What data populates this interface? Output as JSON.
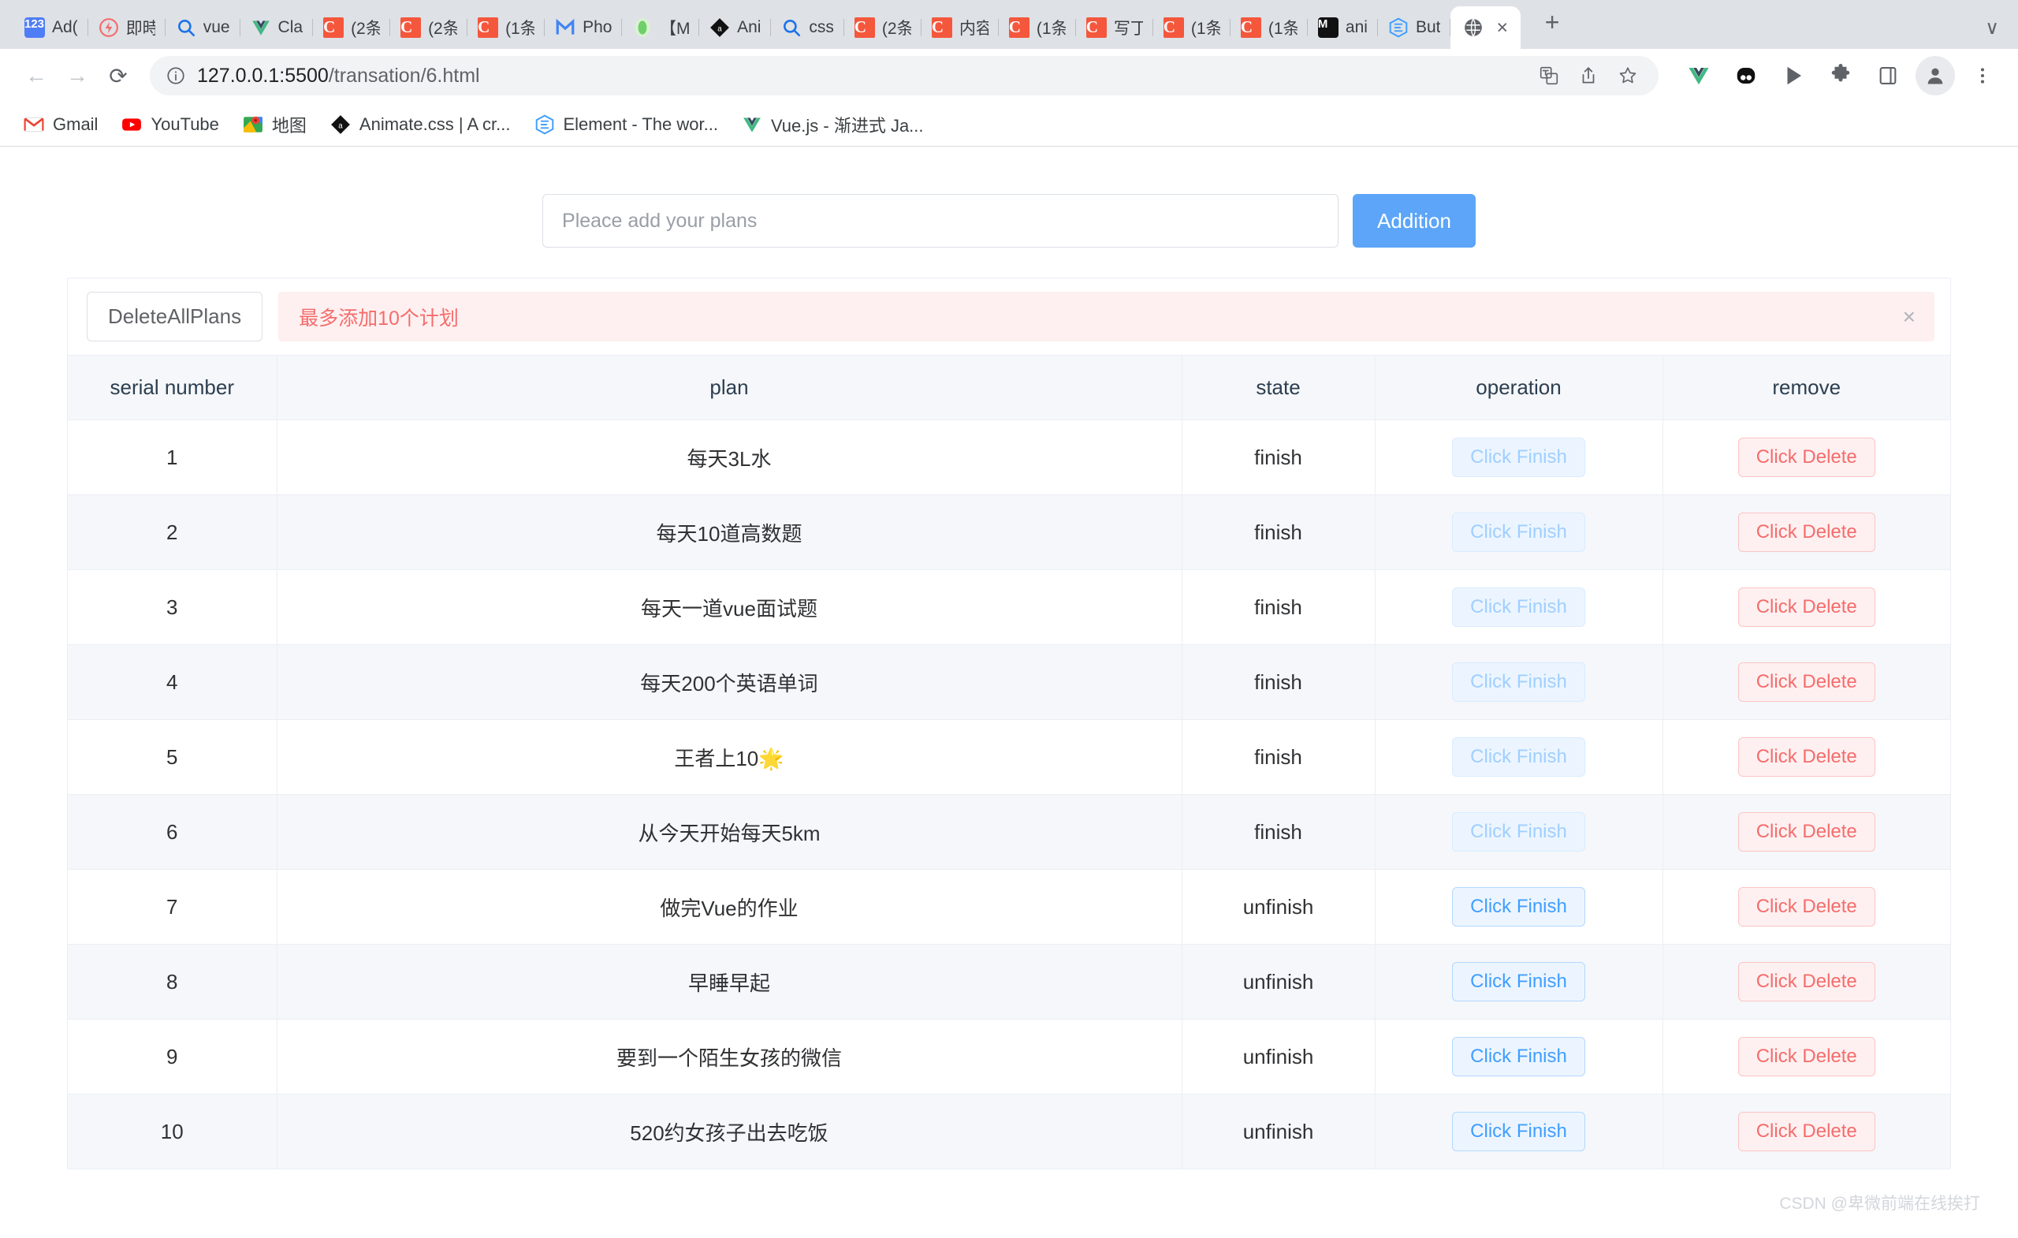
{
  "browser": {
    "tabs": [
      {
        "label": "Ad(",
        "icon": "123-blue-icon",
        "icon_type": "sq",
        "icon_bg": "#4f7df5",
        "icon_text": "123"
      },
      {
        "label": "即時",
        "icon": "lightning-red-icon",
        "icon_type": "circle",
        "icon_bg": "#f56c6c",
        "icon_text": "⚡"
      },
      {
        "label": "vue",
        "icon": "search-blue-icon",
        "icon_type": "glyph",
        "icon_bg": "",
        "icon_text": "🔍"
      },
      {
        "label": "Cla",
        "icon": "vue-icon",
        "icon_type": "vue",
        "icon_bg": "",
        "icon_text": ""
      },
      {
        "label": "(2条",
        "icon": "csdn-icon",
        "icon_type": "c",
        "icon_bg": "#f4573c",
        "icon_text": "C"
      },
      {
        "label": "(2条",
        "icon": "csdn-icon",
        "icon_type": "c",
        "icon_bg": "#f4573c",
        "icon_text": "C"
      },
      {
        "label": "(1条",
        "icon": "csdn-icon",
        "icon_type": "c",
        "icon_bg": "#f4573c",
        "icon_text": "C"
      },
      {
        "label": "Pho",
        "icon": "gmail-m-icon",
        "icon_type": "m",
        "icon_bg": "",
        "icon_text": "M"
      },
      {
        "label": "【M",
        "icon": "green-leaf-icon",
        "icon_type": "leaf",
        "icon_bg": "#6fcf6a",
        "icon_text": ""
      },
      {
        "label": "Ani",
        "icon": "animate-css-icon",
        "icon_type": "diamond",
        "icon_bg": "#111111",
        "icon_text": "a"
      },
      {
        "label": "css",
        "icon": "search-blue-icon",
        "icon_type": "glyph",
        "icon_bg": "",
        "icon_text": "🔍"
      },
      {
        "label": "(2条",
        "icon": "csdn-icon",
        "icon_type": "c",
        "icon_bg": "#f4573c",
        "icon_text": "C"
      },
      {
        "label": "内容",
        "icon": "csdn-icon",
        "icon_type": "c",
        "icon_bg": "#f4573c",
        "icon_text": "C"
      },
      {
        "label": "(1条",
        "icon": "csdn-icon",
        "icon_type": "c",
        "icon_bg": "#f4573c",
        "icon_text": "C"
      },
      {
        "label": "写丁",
        "icon": "csdn-icon",
        "icon_type": "c",
        "icon_bg": "#f4573c",
        "icon_text": "C"
      },
      {
        "label": "(1条",
        "icon": "csdn-icon",
        "icon_type": "c",
        "icon_bg": "#f4573c",
        "icon_text": "C"
      },
      {
        "label": "(1条",
        "icon": "csdn-icon",
        "icon_type": "c",
        "icon_bg": "#f4573c",
        "icon_text": "C"
      },
      {
        "label": "ani",
        "icon": "medium-icon",
        "icon_type": "sq",
        "icon_bg": "#111111",
        "icon_text": "M"
      },
      {
        "label": "But",
        "icon": "element-ui-icon",
        "icon_type": "element",
        "icon_bg": "",
        "icon_text": ""
      }
    ],
    "active_tab": {
      "label": "",
      "icon": "globe-icon",
      "close_label": "×"
    },
    "new_tab_label": "+",
    "tab_list_label": "∨",
    "nav": {
      "back_label": "←",
      "forward_label": "→",
      "reload_label": "⟳",
      "site_info_label": "ⓘ"
    },
    "url": {
      "host": "127.0.0.1:5500",
      "path": "/transation/6.html"
    },
    "omnibox_actions": [
      "translate-icon",
      "share-icon",
      "bookmark-star-icon"
    ],
    "toolbar_icons": [
      "vue-devtools-icon",
      "extension-dark-icon",
      "play-icon",
      "puzzle-icon",
      "sidepanel-icon",
      "profile-avatar-icon",
      "chrome-menu-icon"
    ],
    "bookmarks": [
      {
        "label": "Gmail",
        "icon": "gmail-icon"
      },
      {
        "label": "YouTube",
        "icon": "youtube-icon"
      },
      {
        "label": "地图",
        "icon": "google-maps-icon"
      },
      {
        "label": "Animate.css | A cr...",
        "icon": "animate-css-icon"
      },
      {
        "label": "Element - The wor...",
        "icon": "element-ui-icon"
      },
      {
        "label": "Vue.js - 渐进式 Ja...",
        "icon": "vue-icon"
      }
    ]
  },
  "app": {
    "input": {
      "placeholder": "Pleace add your plans",
      "value": ""
    },
    "add_button_label": "Addition",
    "delete_all_label": "DeleteAllPlans",
    "alert": {
      "text": "最多添加10个计划",
      "close_label": "×"
    },
    "table": {
      "columns": [
        "serial number",
        "plan",
        "state",
        "operation",
        "remove"
      ],
      "finish_label": "Click Finish",
      "delete_label": "Click Delete",
      "rows": [
        {
          "serial": "1",
          "plan": "每天3L水",
          "state": "finish",
          "finish_enabled": false
        },
        {
          "serial": "2",
          "plan": "每天10道高数题",
          "state": "finish",
          "finish_enabled": false
        },
        {
          "serial": "3",
          "plan": "每天一道vue面试题",
          "state": "finish",
          "finish_enabled": false
        },
        {
          "serial": "4",
          "plan": "每天200个英语单词",
          "state": "finish",
          "finish_enabled": false
        },
        {
          "serial": "5",
          "plan": "王者上10🌟",
          "state": "finish",
          "finish_enabled": false
        },
        {
          "serial": "6",
          "plan": "从今天开始每天5km",
          "state": "finish",
          "finish_enabled": false
        },
        {
          "serial": "7",
          "plan": "做完Vue的作业",
          "state": "unfinish",
          "finish_enabled": true
        },
        {
          "serial": "8",
          "plan": "早睡早起",
          "state": "unfinish",
          "finish_enabled": true
        },
        {
          "serial": "9",
          "plan": "要到一个陌生女孩的微信",
          "state": "unfinish",
          "finish_enabled": true
        },
        {
          "serial": "10",
          "plan": "520约女孩子出去吃饭",
          "state": "unfinish",
          "finish_enabled": true
        }
      ]
    },
    "watermark": "CSDN @卑微前端在线挨打",
    "colors": {
      "primary": "#5ca5f8",
      "danger": "#f56c6c",
      "header_bg": "#f5f7fa"
    }
  }
}
